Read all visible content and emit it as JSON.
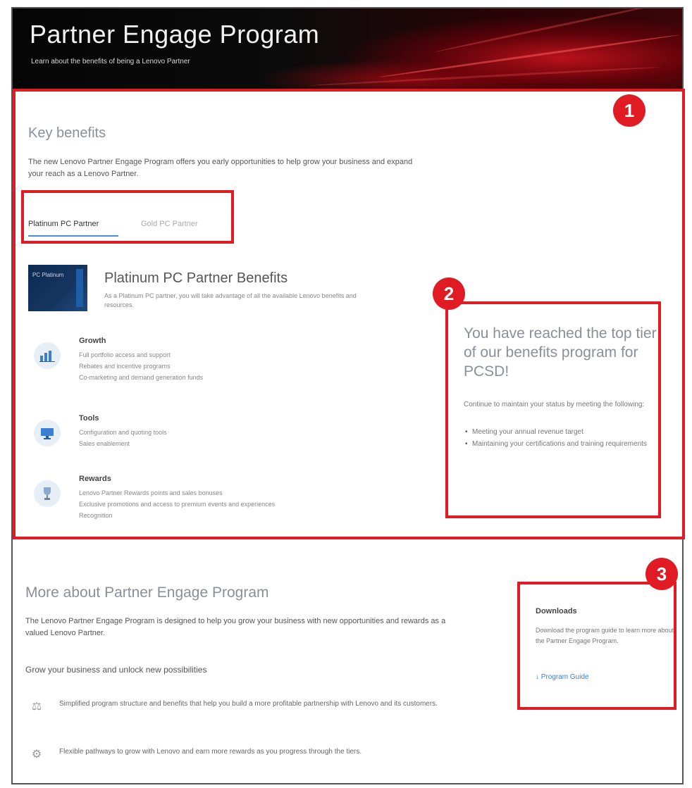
{
  "banner": {
    "title": "Partner Engage Program",
    "subtitle": "Learn about the benefits of being a Lenovo Partner"
  },
  "annotations": [
    "1",
    "2",
    "3"
  ],
  "key_benefits": {
    "title": "Key benefits",
    "description": "The new Lenovo Partner Engage Program offers you early opportunities to help grow your business and expand your reach as a Lenovo Partner.",
    "tabs": [
      "Platinum PC Partner",
      "Gold PC Partner"
    ],
    "tier_badge_text": "PC Platinum"
  },
  "benefit": {
    "title": "Platinum PC Partner Benefits",
    "description": "As a Platinum PC partner, you will take advantage of all the available Lenovo benefits and resources."
  },
  "features": [
    {
      "title": "Growth",
      "icon": "chart-icon",
      "lines": [
        "Full portfolio access and support",
        "Rebates and incentive programs",
        "Co-marketing and demand generation funds"
      ]
    },
    {
      "title": "Tools",
      "icon": "monitor-icon",
      "lines": [
        "Configuration and quoting tools",
        "Sales enablement"
      ]
    },
    {
      "title": "Rewards",
      "icon": "trophy-icon",
      "lines": [
        "Lenovo Partner Rewards points and sales bonuses",
        "Exclusive promotions and access to premium events and experiences",
        "Recognition"
      ]
    }
  ],
  "promo": {
    "title": "You have reached the top tier of our benefits program for PCSD!",
    "text": "Continue to maintain your status by meeting the following:",
    "items": [
      "Meeting your annual revenue target",
      "Maintaining your certifications and training requirements"
    ]
  },
  "about": {
    "title": "More about Partner Engage Program",
    "description": "The Lenovo Partner Engage Program is designed to help you grow your business with new opportunities and rewards as a valued Lenovo Partner.",
    "grow_title": "Grow your business and unlock new possibilities",
    "items": [
      "Simplified program structure and benefits that help you build a more profitable partnership with Lenovo and its customers.",
      "Flexible pathways to grow with Lenovo and earn more rewards as you progress through the tiers."
    ]
  },
  "download": {
    "title": "Downloads",
    "text": "Download the program guide to learn more about the Partner Engage Program.",
    "link_label": "Program Guide"
  },
  "colors": {
    "callout": "#e01b24",
    "accent": "#4a8fd6",
    "link": "#3a7fd1"
  }
}
